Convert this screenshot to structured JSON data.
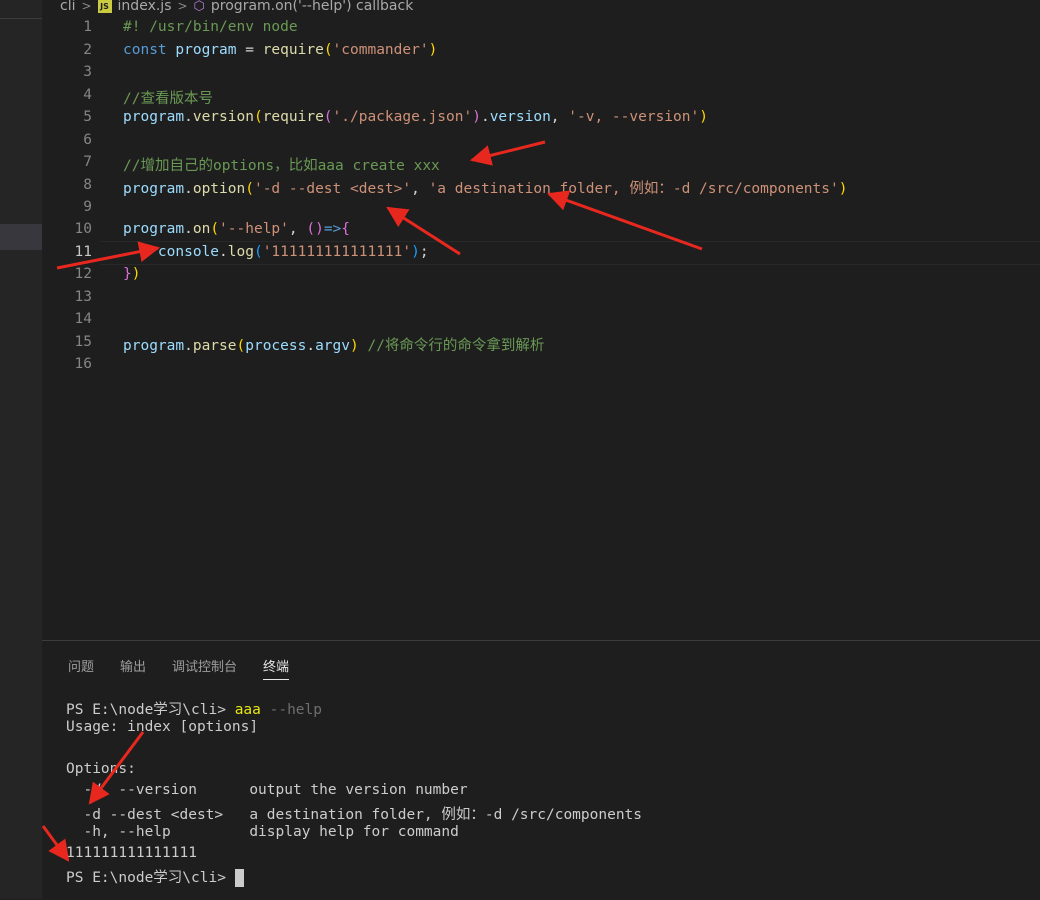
{
  "breadcrumb": {
    "folder": "cli",
    "file": "index.js",
    "file_icon": "JS",
    "symbol": "program.on('--help') callback"
  },
  "editor": {
    "current_line": 11,
    "line_numbers": [
      "1",
      "2",
      "3",
      "4",
      "5",
      "6",
      "7",
      "8",
      "9",
      "10",
      "11",
      "12",
      "13",
      "14",
      "15",
      "16"
    ]
  },
  "panel": {
    "tabs": [
      "问题",
      "输出",
      "调试控制台",
      "终端"
    ],
    "active_tab": "终端"
  },
  "terminal": {
    "prompt1": "PS E:\\node学习\\cli> ",
    "cmd": "aaa",
    "cmd_arg": " --help",
    "usage": "Usage: index [options]",
    "options_header": "Options:",
    "opt1": "  -V, --version      output the version number",
    "opt2": "  -d --dest <dest>   a destination folder, 例如：-d /src/components",
    "opt3": "  -h, --help         display help for command",
    "output": "111111111111111",
    "prompt2": "PS E:\\node学习\\cli> "
  },
  "colors": {
    "background": "#1e1e1e",
    "keyword": "#569cd6",
    "variable": "#9cdcfe",
    "function": "#dcdcaa",
    "string": "#ce9178",
    "comment": "#6a9955",
    "arrow": "#e8281e"
  }
}
